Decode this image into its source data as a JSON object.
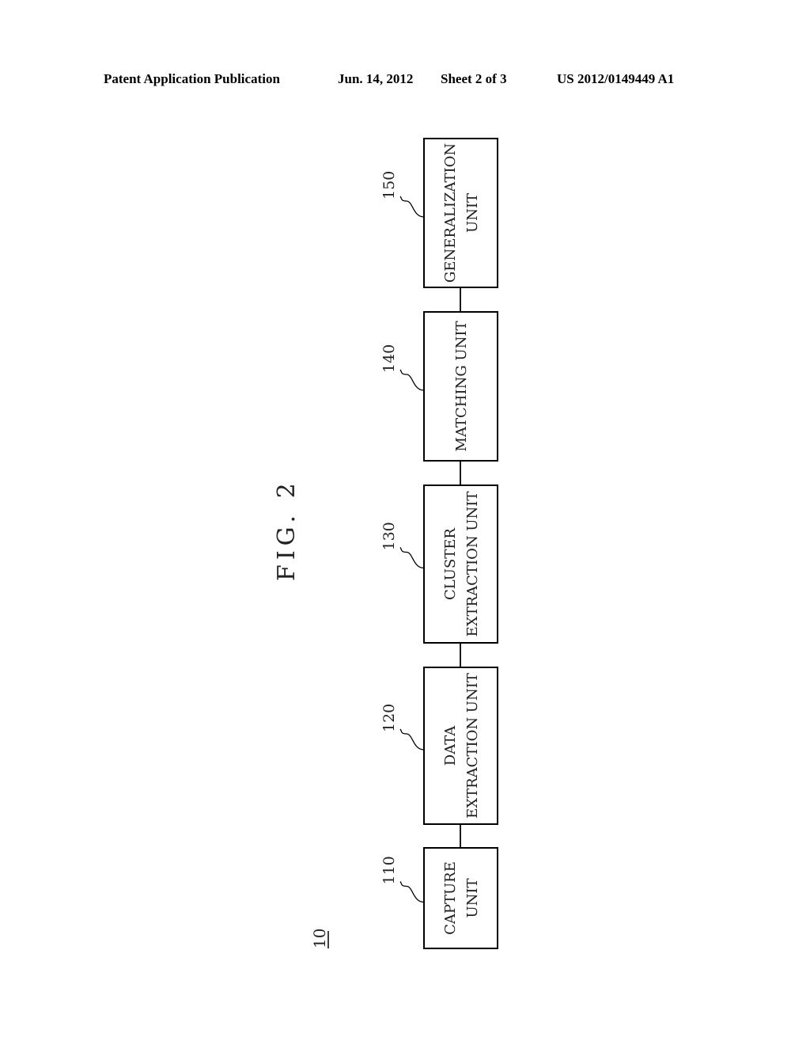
{
  "header": {
    "publication": "Patent Application Publication",
    "date": "Jun. 14, 2012",
    "sheet": "Sheet 2 of 3",
    "patent_number": "US 2012/0149449 A1"
  },
  "figure": {
    "label": "FIG. 2",
    "system_ref": "10",
    "blocks": [
      {
        "ref": "150",
        "lines": [
          "GENERALIZATION",
          "UNIT"
        ]
      },
      {
        "ref": "140",
        "lines": [
          "MATCHING UNIT"
        ]
      },
      {
        "ref": "130",
        "lines": [
          "CLUSTER",
          "EXTRACTION UNIT"
        ]
      },
      {
        "ref": "120",
        "lines": [
          "DATA",
          "EXTRACTION UNIT"
        ]
      },
      {
        "ref": "110",
        "lines": [
          "CAPTURE",
          "UNIT"
        ]
      }
    ]
  }
}
